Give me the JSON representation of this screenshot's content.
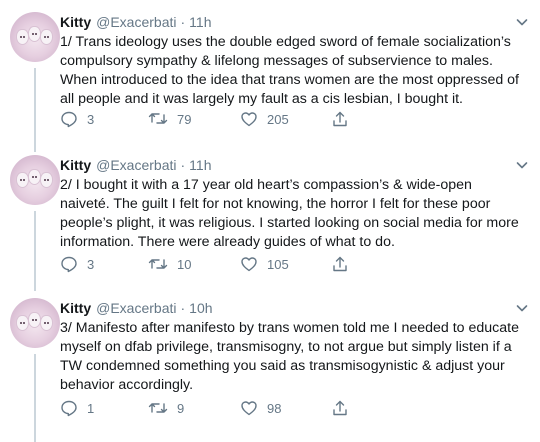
{
  "tweets": [
    {
      "name": "Kitty",
      "handle": "@Exacerbati",
      "separator": "·",
      "time": "11h",
      "text": "1/ Trans ideology uses the double edged sword of female socialization’s compulsory sympathy & lifelong messages of subservience to males. When introduced to the idea that trans women are the most oppressed of all people and it was largely my fault as a cis lesbian, I bought it.",
      "replies": "3",
      "retweets": "79",
      "likes": "205"
    },
    {
      "name": "Kitty",
      "handle": "@Exacerbati",
      "separator": "·",
      "time": "11h",
      "text": "2/ I bought it with a 17 year old heart’s compassion’s & wide-open naiveté. The guilt I felt for not knowing, the horror I felt for these poor people’s plight, it was religious. I started looking on social media for more information. There were already guides of what to do.",
      "replies": "3",
      "retweets": "10",
      "likes": "105"
    },
    {
      "name": "Kitty",
      "handle": "@Exacerbati",
      "separator": "·",
      "time": "10h",
      "text": "3/ Manifesto after manifesto by trans women told me I needed to educate myself on dfab privilege, transmisogny, to not argue but simply listen if a TW condemned something you said as transmisogynistic & adjust your behavior accordingly.",
      "replies": "1",
      "retweets": "9",
      "likes": "98"
    }
  ],
  "icons": {
    "reply": "reply-icon",
    "retweet": "retweet-icon",
    "like": "heart-icon",
    "share": "share-icon",
    "menu": "chevron-down-icon"
  },
  "colors": {
    "text": "#14171a",
    "secondary": "#657786",
    "thread_line": "#ccd6dd"
  }
}
